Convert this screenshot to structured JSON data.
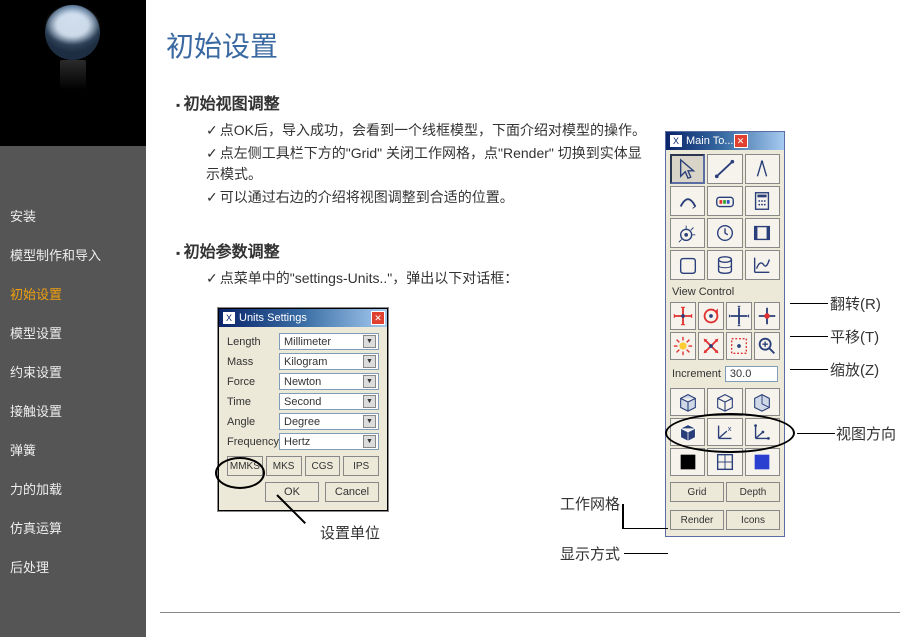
{
  "title": "初始设置",
  "sidebar": {
    "items": [
      {
        "label": "安装",
        "active": false
      },
      {
        "label": "模型制作和导入",
        "active": false
      },
      {
        "label": "初始设置",
        "active": true
      },
      {
        "label": "模型设置",
        "active": false
      },
      {
        "label": "约束设置",
        "active": false
      },
      {
        "label": "接触设置",
        "active": false
      },
      {
        "label": "弹簧",
        "active": false
      },
      {
        "label": "力的加载",
        "active": false
      },
      {
        "label": "仿真运算",
        "active": false
      },
      {
        "label": "后处理",
        "active": false
      }
    ]
  },
  "sections": {
    "s1_head": "初始视图调整",
    "s1_b1": "点OK后，导入成功，会看到一个线框模型，下面介绍对模型的操作。",
    "s1_b2": "点左侧工具栏下方的\"Grid\" 关闭工作网格，点\"Render\" 切换到实体显示模式。",
    "s1_b3": "可以通过右边的介绍将视图调整到合适的位置。",
    "s2_head": "初始参数调整",
    "s2_b1": "点菜单中的\"settings-Units..\"，弹出以下对话框："
  },
  "units_dialog": {
    "title": "Units Settings",
    "rows": [
      {
        "label": "Length",
        "value": "Millimeter"
      },
      {
        "label": "Mass",
        "value": "Kilogram"
      },
      {
        "label": "Force",
        "value": "Newton"
      },
      {
        "label": "Time",
        "value": "Second"
      },
      {
        "label": "Angle",
        "value": "Degree"
      },
      {
        "label": "Frequency",
        "value": "Hertz"
      }
    ],
    "presets": [
      "MMKS",
      "MKS",
      "CGS",
      "IPS"
    ],
    "ok": "OK",
    "cancel": "Cancel"
  },
  "set_unit_label": "设置单位",
  "toolbox": {
    "title": "Main To...",
    "view_control_label": "View Control",
    "increment_label": "Increment",
    "increment_value": "30.0",
    "grid_btn": "Grid",
    "depth_btn": "Depth",
    "render_btn": "Render",
    "icons_btn": "Icons"
  },
  "annotations": {
    "rotate": "翻转(R)",
    "pan": "平移(T)",
    "zoom": "缩放(Z)",
    "view_dir": "视图方向",
    "grid_label": "工作网格",
    "display_mode": "显示方式"
  }
}
